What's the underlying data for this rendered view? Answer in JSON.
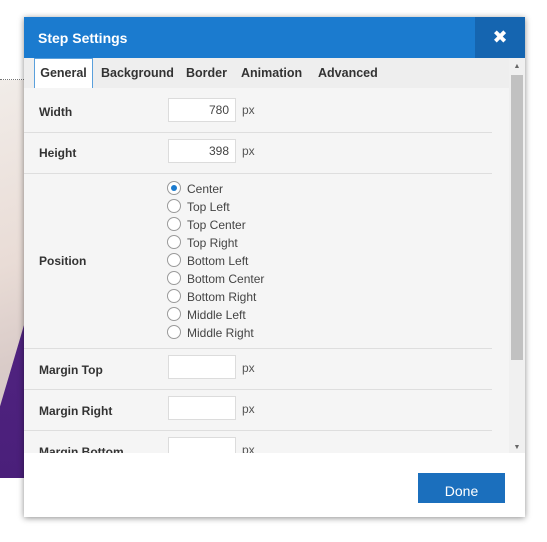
{
  "dialog": {
    "title": "Step Settings",
    "close_icon": "✖",
    "accent_color": "#1b7bcf",
    "tabs": [
      {
        "label": "General",
        "active": true
      },
      {
        "label": "Background"
      },
      {
        "label": "Border"
      },
      {
        "label": "Animation"
      },
      {
        "label": "Advanced"
      }
    ],
    "fields": {
      "width": {
        "label": "Width",
        "value": "780",
        "unit": "px"
      },
      "height": {
        "label": "Height",
        "value": "398",
        "unit": "px"
      },
      "position": {
        "label": "Position",
        "selected": "Center",
        "options": [
          "Center",
          "Top Left",
          "Top Center",
          "Top Right",
          "Bottom Left",
          "Bottom Center",
          "Bottom Right",
          "Middle Left",
          "Middle Right"
        ]
      },
      "margin_top": {
        "label": "Margin Top",
        "value": "",
        "unit": "px"
      },
      "margin_right": {
        "label": "Margin Right",
        "value": "",
        "unit": "px"
      },
      "margin_bottom": {
        "label": "Margin Bottom",
        "value": "",
        "unit": "px"
      }
    },
    "done_label": "Done",
    "scroll_up_icon": "▲",
    "scroll_down_icon": "▼"
  }
}
